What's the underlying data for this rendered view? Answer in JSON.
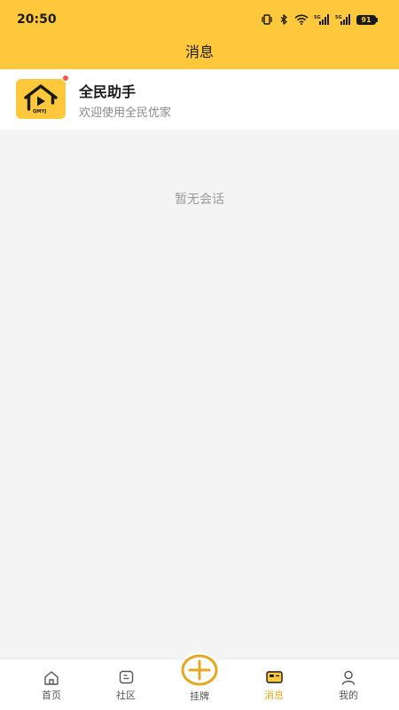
{
  "status_bar": {
    "time": "20:50",
    "battery": "91"
  },
  "header": {
    "title": "消息"
  },
  "conversations": [
    {
      "name": "全民助手",
      "preview": "欢迎使用全民优家",
      "avatar_text": "QMYJ",
      "unread": true
    }
  ],
  "empty_state": "暂无会话",
  "tabs": [
    {
      "label": "首页",
      "icon": "home-icon"
    },
    {
      "label": "社区",
      "icon": "community-icon"
    },
    {
      "label": "挂牌",
      "icon": "plus-circle-icon"
    },
    {
      "label": "消息",
      "icon": "message-icon",
      "active": true
    },
    {
      "label": "我的",
      "icon": "profile-icon"
    }
  ],
  "colors": {
    "brand": "#fec83c",
    "active_tab": "#e6a820",
    "unread": "#f05a4a",
    "background": "#f4f4f4"
  }
}
